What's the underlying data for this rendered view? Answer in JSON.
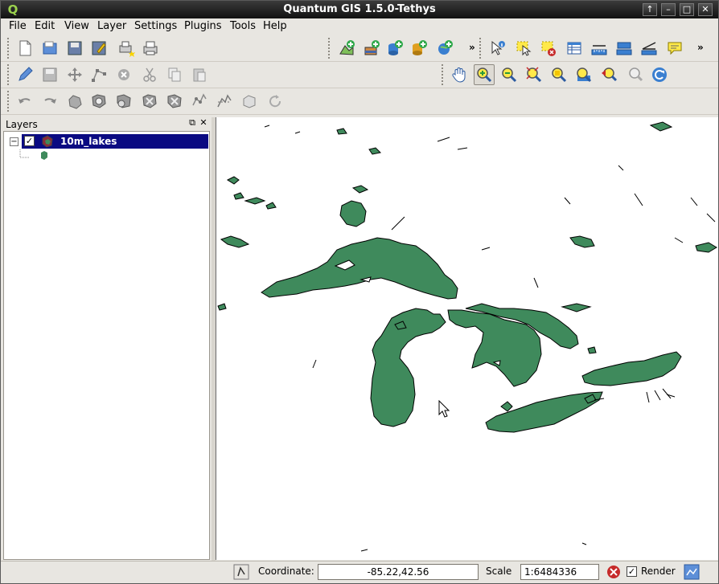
{
  "window": {
    "title": "Quantum GIS 1.5.0-Tethys",
    "app_icon": "qgis-logo-icon"
  },
  "window_controls": [
    "maximize-up-icon",
    "minimize-icon",
    "maximize-icon",
    "close-icon"
  ],
  "menubar": {
    "items": [
      {
        "label": "File",
        "mnemonic": "F"
      },
      {
        "label": "Edit",
        "mnemonic": "E"
      },
      {
        "label": "View",
        "mnemonic": "V"
      },
      {
        "label": "Layer",
        "mnemonic": "L"
      },
      {
        "label": "Settings",
        "mnemonic": "S"
      },
      {
        "label": "Plugins",
        "mnemonic": "P"
      },
      {
        "label": "Tools",
        "mnemonic": "T"
      },
      {
        "label": "Help",
        "mnemonic": "H"
      }
    ]
  },
  "toolbars": {
    "file": [
      "new-project-icon",
      "open-project-icon",
      "save-project-icon",
      "save-as-icon",
      "print-composer-icon",
      "print-icon"
    ],
    "layers": [
      "add-vector-layer-icon",
      "add-raster-layer-icon",
      "add-postgis-layer-icon",
      "add-spatialite-layer-icon",
      "add-wms-layer-icon"
    ],
    "attributes": [
      "identify-icon",
      "select-features-icon",
      "deselect-features-icon",
      "open-attribute-table-icon",
      "measure-line-icon",
      "measure-area-icon",
      "measure-angle-icon",
      "map-tips-icon"
    ],
    "digitizing": [
      "toggle-editing-icon",
      "save-edits-icon",
      "move-feature-icon",
      "node-tool-icon",
      "delete-selected-icon",
      "cut-features-icon",
      "copy-features-icon",
      "paste-features-icon"
    ],
    "navigation": [
      "pan-icon",
      "zoom-in-icon",
      "zoom-out-icon",
      "zoom-full-icon",
      "zoom-to-selection-icon",
      "zoom-to-layer-icon",
      "zoom-last-icon",
      "zoom-next-icon",
      "refresh-icon"
    ],
    "advanced": [
      "undo-icon",
      "redo-icon",
      "simplify-feature-icon",
      "add-ring-icon",
      "add-part-icon",
      "delete-ring-icon",
      "delete-part-icon",
      "reshape-icon",
      "split-features-icon",
      "merge-features-icon",
      "rotate-label-icon"
    ]
  },
  "layers_panel": {
    "title": "Layers",
    "layers": [
      {
        "name": "10m_lakes",
        "visible": true,
        "fill": "#3f8a5c"
      }
    ]
  },
  "statusbar": {
    "coordinate_label": "Coordinate:",
    "coordinate_value": "-85.22,42.56",
    "scale_label": "Scale",
    "scale_value": "1:6484336",
    "render_label": "Render",
    "render_checked": true
  },
  "colors": {
    "lake_fill": "#3f8a5c",
    "layer_highlight": "#0a0a82",
    "titlebar": "#1a1a1a"
  }
}
